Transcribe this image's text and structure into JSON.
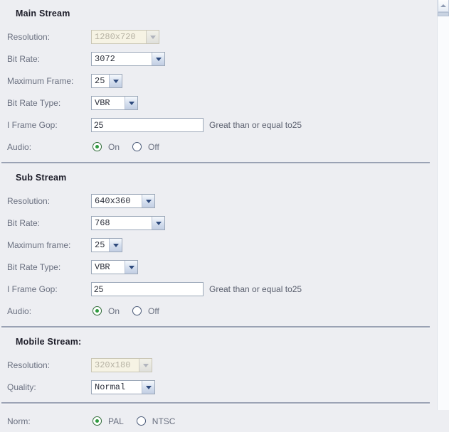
{
  "scrollbar": {
    "up_arrow_icon": "chevron-up-icon"
  },
  "sections": [
    {
      "title": "Main Stream",
      "rows": [
        {
          "label": "Resolution:",
          "type": "select",
          "value": "1280x720",
          "disabled": true
        },
        {
          "label": "Bit Rate:",
          "type": "select",
          "value": "3072",
          "disabled": false
        },
        {
          "label": "Maximum Frame:",
          "type": "select",
          "value": "25",
          "disabled": false
        },
        {
          "label": "Bit Rate Type:",
          "type": "select",
          "value": "VBR",
          "disabled": false
        },
        {
          "label": "I Frame Gop:",
          "type": "text",
          "value": "25",
          "hint": "Great than or equal to25"
        },
        {
          "label": "Audio:",
          "type": "radio",
          "options": [
            "On",
            "Off"
          ],
          "selected": "On"
        }
      ]
    },
    {
      "title": "Sub Stream",
      "rows": [
        {
          "label": "Resolution:",
          "type": "select",
          "value": "640x360",
          "disabled": false
        },
        {
          "label": "Bit Rate:",
          "type": "select",
          "value": "768",
          "disabled": false
        },
        {
          "label": "Maximum frame:",
          "type": "select",
          "value": "25",
          "disabled": false
        },
        {
          "label": "Bit Rate Type:",
          "type": "select",
          "value": "VBR",
          "disabled": false
        },
        {
          "label": "I Frame Gop:",
          "type": "text",
          "value": "25",
          "hint": "Great than or equal to25"
        },
        {
          "label": "Audio:",
          "type": "radio",
          "options": [
            "On",
            "Off"
          ],
          "selected": "On"
        }
      ]
    },
    {
      "title": "Mobile Stream:",
      "rows": [
        {
          "label": "Resolution:",
          "type": "select",
          "value": "320x180",
          "disabled": true
        },
        {
          "label": "Quality:",
          "type": "select",
          "value": "Normal",
          "disabled": false
        }
      ]
    },
    {
      "title": null,
      "rows": [
        {
          "label": "Norm:",
          "type": "radio",
          "options": [
            "PAL",
            "NTSC"
          ],
          "selected": "PAL"
        }
      ]
    }
  ],
  "main_stream": {
    "title": "Main Stream",
    "resolution": {
      "label": "Resolution:",
      "value": "1280x720"
    },
    "bit_rate": {
      "label": "Bit Rate:",
      "value": "3072"
    },
    "maximum_frame": {
      "label": "Maximum Frame:",
      "value": "25"
    },
    "bit_rate_type": {
      "label": "Bit Rate Type:",
      "value": "VBR"
    },
    "i_frame_gop": {
      "label": "I Frame Gop:",
      "value": "25",
      "hint": "Great than or equal to25"
    },
    "audio": {
      "label": "Audio:",
      "on": "On",
      "off": "Off",
      "selected": "On"
    }
  },
  "sub_stream": {
    "title": "Sub Stream",
    "resolution": {
      "label": "Resolution:",
      "value": "640x360"
    },
    "bit_rate": {
      "label": "Bit Rate:",
      "value": "768"
    },
    "maximum_frame": {
      "label": "Maximum frame:",
      "value": "25"
    },
    "bit_rate_type": {
      "label": "Bit Rate Type:",
      "value": "VBR"
    },
    "i_frame_gop": {
      "label": "I Frame Gop:",
      "value": "25",
      "hint": "Great than or equal to25"
    },
    "audio": {
      "label": "Audio:",
      "on": "On",
      "off": "Off",
      "selected": "On"
    }
  },
  "mobile_stream": {
    "title": "Mobile Stream:",
    "resolution": {
      "label": "Resolution:",
      "value": "320x180"
    },
    "quality": {
      "label": "Quality:",
      "value": "Normal"
    }
  },
  "norm": {
    "label": "Norm:",
    "pal": "PAL",
    "ntsc": "NTSC",
    "selected": "PAL"
  },
  "colors": {
    "page_background": "#edeef2",
    "heading_text": "#1c1c28",
    "label_text": "#6a7080",
    "divider": "#9aa2b4",
    "input_border": "#9ba7b8",
    "disabled_background": "#f6f3e4",
    "radio_selected": "#2f9b3f",
    "dropdown_arrow": "#2e4a7d"
  }
}
